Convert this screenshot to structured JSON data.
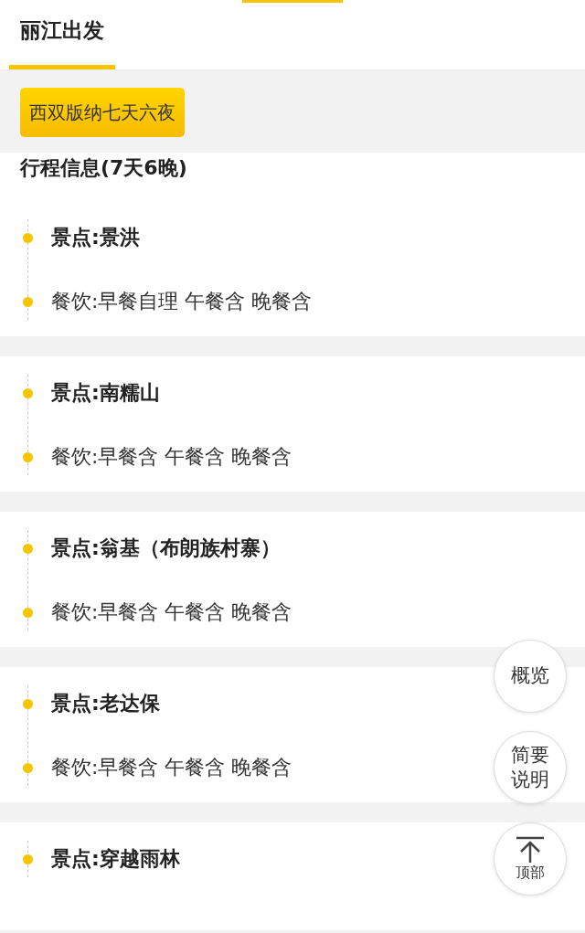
{
  "tabs": [
    {
      "label": "丽江出发",
      "selected": true
    }
  ],
  "routes": [
    {
      "label": "西双版纳七天六夜",
      "selected": true
    }
  ],
  "itinerary": {
    "title": "行程信息(7天6晚)",
    "days": [
      {
        "items": [
          {
            "kind": "sight",
            "text": "景点:景洪"
          },
          {
            "kind": "meal",
            "text": "餐饮:早餐自理 午餐含 晚餐含"
          }
        ]
      },
      {
        "items": [
          {
            "kind": "sight",
            "text": "景点:南糯山"
          },
          {
            "kind": "meal",
            "text": "餐饮:早餐含 午餐含 晚餐含"
          }
        ]
      },
      {
        "items": [
          {
            "kind": "sight",
            "text": "景点:翁基（布朗族村寨）"
          },
          {
            "kind": "meal",
            "text": "餐饮:早餐含 午餐含 晚餐含"
          }
        ]
      },
      {
        "items": [
          {
            "kind": "sight",
            "text": "景点:老达保"
          },
          {
            "kind": "meal",
            "text": "餐饮:早餐含 午餐含 晚餐含"
          }
        ]
      },
      {
        "items": [
          {
            "kind": "sight",
            "text": "景点:穿越雨林"
          }
        ]
      }
    ]
  },
  "float_buttons": [
    {
      "kind": "text",
      "label": "概览"
    },
    {
      "kind": "text",
      "label": "简要说明"
    },
    {
      "kind": "top",
      "label": "顶部"
    }
  ]
}
